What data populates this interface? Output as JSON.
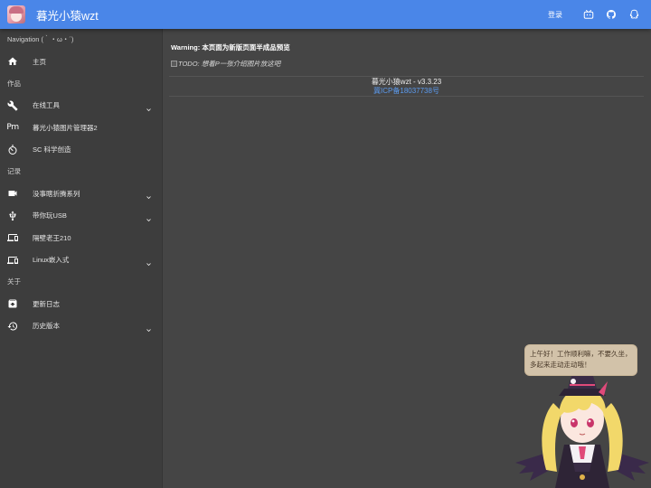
{
  "header": {
    "title": "暮光小猿wzt",
    "login_label": "登录",
    "icons": [
      "bilibili-icon",
      "github-icon",
      "qq-icon"
    ]
  },
  "sidebar": {
    "navigation_label": "Navigation (｀・ω・´)",
    "items": [
      {
        "type": "item",
        "label": "主页",
        "icon": "home-icon",
        "expandable": false
      },
      {
        "type": "section",
        "label": "作品"
      },
      {
        "type": "item",
        "label": "在线工具",
        "icon": "wrench-icon",
        "expandable": true
      },
      {
        "type": "item",
        "label": "暮光小猿图片管理器2",
        "icon": "pm-icon",
        "expandable": false
      },
      {
        "type": "item",
        "label": "SC 科学创造",
        "icon": "timer-icon",
        "expandable": false
      },
      {
        "type": "section",
        "label": "记录"
      },
      {
        "type": "item",
        "label": "没事瞎折腾系列",
        "icon": "videocam-icon",
        "expandable": true
      },
      {
        "type": "item",
        "label": "带你玩USB",
        "icon": "usb-icon",
        "expandable": true
      },
      {
        "type": "item",
        "label": "隔壁老王210",
        "icon": "devices-icon",
        "expandable": false
      },
      {
        "type": "item",
        "label": "Linux嵌入式",
        "icon": "devices-icon",
        "expandable": true
      },
      {
        "type": "section",
        "label": "关于"
      },
      {
        "type": "item",
        "label": "更新日志",
        "icon": "archive-icon",
        "expandable": false
      },
      {
        "type": "item",
        "label": "历史版本",
        "icon": "history-icon",
        "expandable": true
      }
    ]
  },
  "main": {
    "warning_prefix": "Warning: ",
    "warning_text": "本页面为新版页面半成品预览",
    "image_alt": "TODO: 想着P一张介绍图片放这吧",
    "version": "暮光小猿wzt - v3.3.23",
    "icp": "冀ICP备18037738号"
  },
  "mascot": {
    "bubble_text": "上午好！工作顺利嘛，不要久坐，多起来走动走动哦！"
  },
  "colors": {
    "topbar": "#4a86e8",
    "sidebar": "#3d3d3d",
    "content": "#454545",
    "link": "#5c9bef"
  }
}
